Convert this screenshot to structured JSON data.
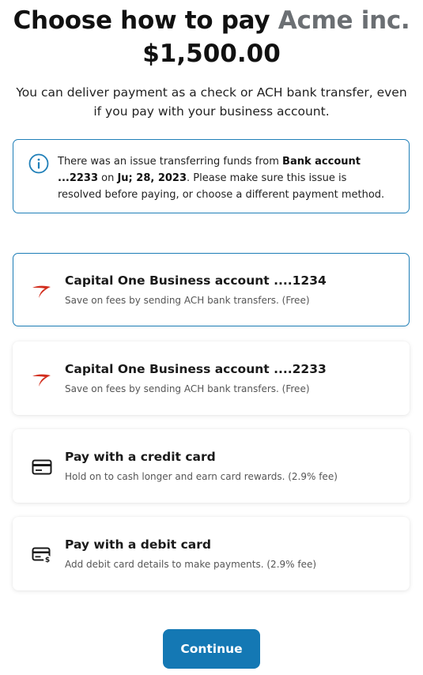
{
  "header": {
    "title_prefix": "Choose how to pay",
    "payee": "Acme inc.",
    "amount": "$1,500.00",
    "subtitle": "You can deliver payment as a check or ACH bank transfer, even if you pay with your business account."
  },
  "alert": {
    "icon": "info-icon",
    "text_1": "There was an issue transferring funds from ",
    "account": "Bank account ...2233",
    "text_2": " on ",
    "date": "Ju; 28, 2023",
    "text_3": ". Please make sure this issue is resolved before paying, or choose a different payment method."
  },
  "options": [
    {
      "icon": "capital-one-logo-icon",
      "title": "Capital One Business account ....1234",
      "description": "Save on fees by sending ACH bank transfers. (Free)",
      "selected": true
    },
    {
      "icon": "capital-one-logo-icon",
      "title": "Capital One Business account ....2233",
      "description": "Save on fees by sending ACH bank transfers. (Free)",
      "selected": false
    },
    {
      "icon": "credit-card-icon",
      "title": "Pay with a credit card",
      "description": "Hold on to cash longer and earn card rewards. (2.9% fee)",
      "selected": false
    },
    {
      "icon": "debit-card-icon",
      "title": "Pay with a debit card",
      "description": "Add debit card details to make payments. (2.9% fee)",
      "selected": false
    }
  ],
  "continue_label": "Continue",
  "colors": {
    "accent": "#1478b4",
    "border_selected": "#1f7fb8",
    "logo_red": "#d22e1e",
    "payee_gray": "#6b6f73"
  }
}
